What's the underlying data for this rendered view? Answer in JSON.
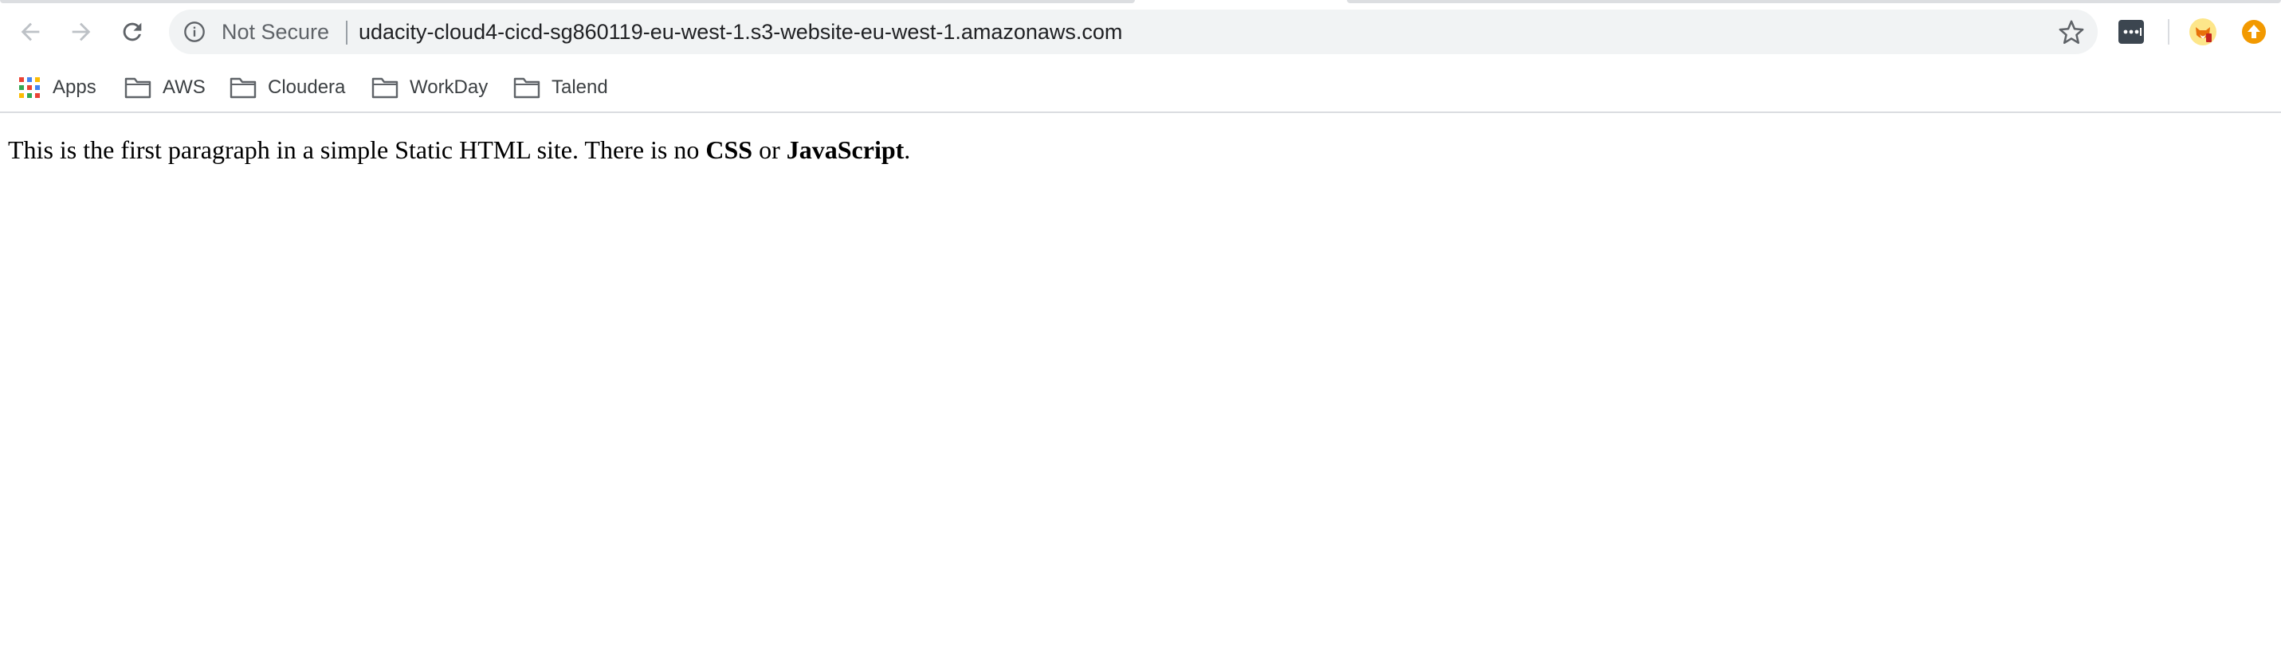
{
  "browser": {
    "omnibox": {
      "security_label": "Not Secure",
      "url": "udacity-cloud4-cicd-sg860119-eu-west-1.s3-website-eu-west-1.amazonaws.com"
    },
    "icons": {
      "back": "arrow-left-icon",
      "forward": "arrow-right-icon",
      "reload": "reload-icon",
      "info": "info-icon",
      "bookmark_star": "star-icon",
      "extension_1": "password-manager-icon",
      "extension_2": "fox-extension-icon",
      "extension_3": "update-arrow-icon"
    },
    "colors": {
      "omnibox_bg": "#f1f3f4",
      "update_badge": "#f29900"
    }
  },
  "bookmarks_bar": {
    "items": [
      {
        "label": "Apps",
        "icon": "apps-grid-icon"
      },
      {
        "label": "AWS",
        "icon": "folder-icon"
      },
      {
        "label": "Cloudera",
        "icon": "folder-icon"
      },
      {
        "label": "WorkDay",
        "icon": "folder-icon"
      },
      {
        "label": "Talend",
        "icon": "folder-icon"
      }
    ]
  },
  "page": {
    "paragraph": {
      "before_css": "This is the first paragraph in a simple Static HTML site. There is no ",
      "css": "CSS",
      "between": " or ",
      "javascript": "JavaScript",
      "end": "."
    }
  }
}
